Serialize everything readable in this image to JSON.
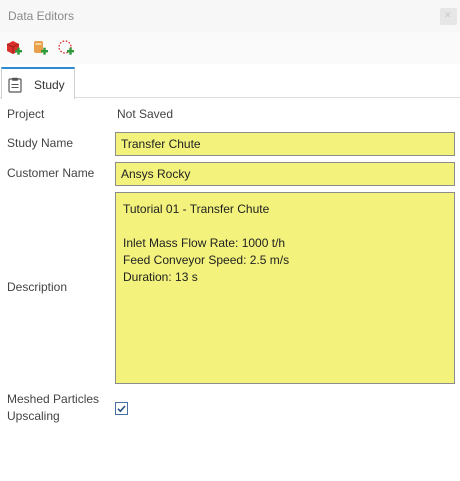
{
  "window": {
    "title": "Data Editors"
  },
  "toolbar": {
    "buttons": [
      {
        "icon": "add-red-cube-icon",
        "color": "#d9302c"
      },
      {
        "icon": "add-orange-item-icon",
        "color": "#e8a04a"
      },
      {
        "icon": "add-dotted-selection-icon",
        "color": "#2e9a3b"
      }
    ]
  },
  "tabs": [
    {
      "label": "Study",
      "icon": "clipboard-icon",
      "active": true
    }
  ],
  "form": {
    "project": {
      "label": "Project",
      "value": "Not Saved"
    },
    "study_name": {
      "label": "Study Name",
      "value": "Transfer Chute"
    },
    "customer_name": {
      "label": "Customer Name",
      "value": "Ansys Rocky"
    },
    "description": {
      "label": "Description",
      "lines": [
        "Tutorial 01 - Transfer Chute",
        "",
        "Inlet Mass Flow Rate: 1000 t/h",
        "Feed Conveyor Speed: 2.5 m/s",
        "Duration: 13 s"
      ]
    },
    "meshed_particles_upscaling": {
      "label_line1": "Meshed Particles",
      "label_line2": "Upscaling",
      "checked": true
    }
  },
  "colors": {
    "field_background": "#f2f27c",
    "tab_accent": "#2e8bd1",
    "add_green": "#2e9a3b"
  }
}
